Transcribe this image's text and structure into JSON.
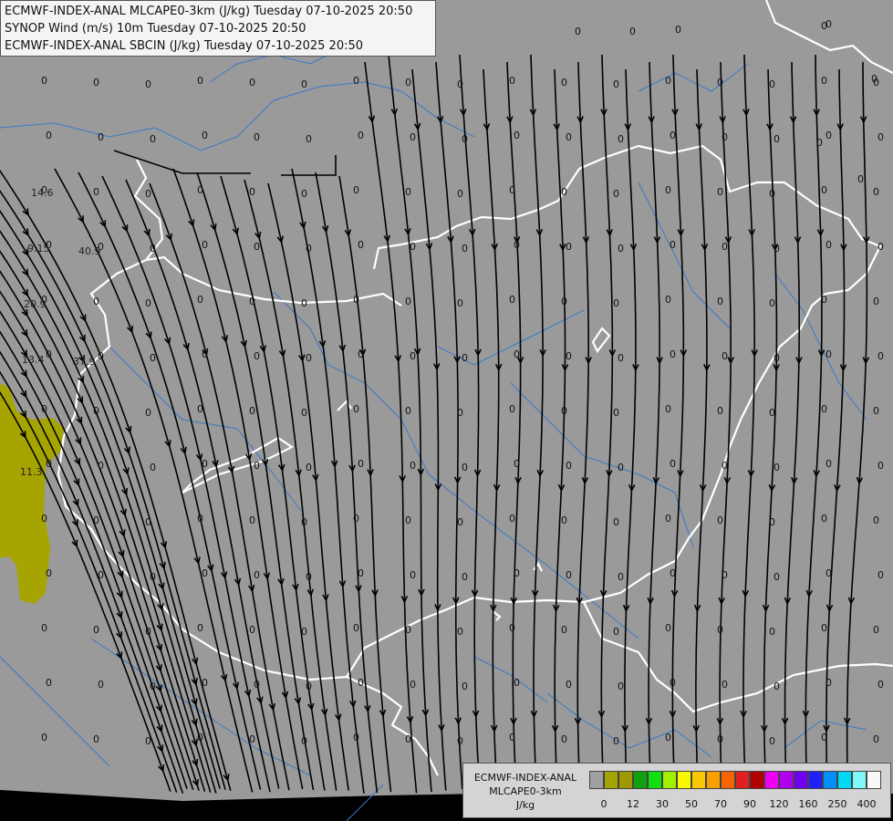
{
  "header": {
    "lines": [
      "ECMWF-INDEX-ANAL MLCAPE0-3km (J/kg) Tuesday 07-10-2025 20:50",
      "SYNOP Wind (m/s) 10m Tuesday 07-10-2025 20:50",
      "ECMWF-INDEX-ANAL SBCIN (J/kg) Tuesday 07-10-2025 20:50"
    ]
  },
  "legend": {
    "title_lines": [
      "ECMWF-INDEX-ANAL",
      "MLCAPE0-3km",
      "J/kg"
    ],
    "colors": [
      "#a0a0a0",
      "#a4a400",
      "#a09800",
      "#10a010",
      "#10e010",
      "#a0f000",
      "#f8f800",
      "#f8c800",
      "#f8a000",
      "#f86400",
      "#e02020",
      "#b00000",
      "#f000f0",
      "#b000f0",
      "#7000f0",
      "#2020f8",
      "#0090f8",
      "#00d8f8",
      "#80f8f8",
      "#f8f8f8"
    ],
    "ticks": [
      "0",
      "12",
      "30",
      "50",
      "70",
      "90",
      "120",
      "160",
      "250",
      "400"
    ]
  },
  "map": {
    "colors": {
      "background": "#9a9a9a",
      "cape_low": "#a6a400",
      "border": "#ffffff",
      "rivers": "#3a78c8",
      "streamlines": "#000000",
      "sea": "#000000"
    },
    "cape_labels": [
      "14.6",
      "9.15",
      "40.9",
      "20.9",
      "13.4",
      "37.9",
      "11.3"
    ],
    "zero_label": "0"
  }
}
